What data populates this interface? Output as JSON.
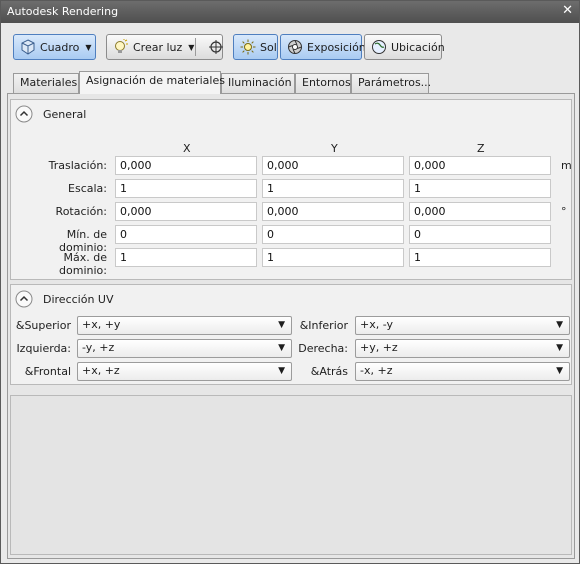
{
  "window": {
    "title": "Autodesk Rendering",
    "close_glyph": "✕"
  },
  "toolbar": {
    "view_button": {
      "label": "Cuadro",
      "icon": "cube-icon"
    },
    "create_light": {
      "label": "Crear luz",
      "icon": "light-bulb-icon"
    },
    "target_icon": "crosshair-target-icon",
    "sun": {
      "label": "Sol",
      "icon": "sun-icon",
      "active": true
    },
    "exposure": {
      "label": "Exposición",
      "icon": "aperture-icon",
      "active": true
    },
    "location": {
      "label": "Ubicación",
      "icon": "globe-icon",
      "active": false
    }
  },
  "tabs": [
    {
      "label": "Materiales",
      "active": false
    },
    {
      "label": "Asignación de materiales",
      "active": true
    },
    {
      "label": "Iluminación",
      "active": false
    },
    {
      "label": "Entornos",
      "active": false
    },
    {
      "label": "Parámetros...",
      "active": false
    }
  ],
  "general": {
    "title": "General",
    "axes": [
      "X",
      "Y",
      "Z"
    ],
    "rows": [
      {
        "label": "Traslación:",
        "x": "0,000",
        "y": "0,000",
        "z": "0,000",
        "unit": "m"
      },
      {
        "label": "Escala:",
        "x": "1",
        "y": "1",
        "z": "1",
        "unit": ""
      },
      {
        "label": "Rotación:",
        "x": "0,000",
        "y": "0,000",
        "z": "0,000",
        "unit": "°"
      },
      {
        "label": "Mín. de dominio:",
        "x": "0",
        "y": "0",
        "z": "0",
        "unit": ""
      },
      {
        "label": "Máx. de dominio:",
        "x": "1",
        "y": "1",
        "z": "1",
        "unit": ""
      }
    ]
  },
  "uv": {
    "title": "Dirección UV",
    "fields": [
      {
        "label": "&Superior",
        "value": "+x, +y"
      },
      {
        "label": "&Inferior",
        "value": "+x, -y"
      },
      {
        "label": "Izquierda:",
        "value": "-y, +z"
      },
      {
        "label": "Derecha:",
        "value": "+y, +z"
      },
      {
        "label": "&Frontal",
        "value": "+x, +z"
      },
      {
        "label": "&Atrás",
        "value": "-x, +z"
      }
    ]
  },
  "colors": {
    "accent": "#4f7fbf",
    "titlebar": "#5c5c5c",
    "panel": "#f1f1f1"
  }
}
